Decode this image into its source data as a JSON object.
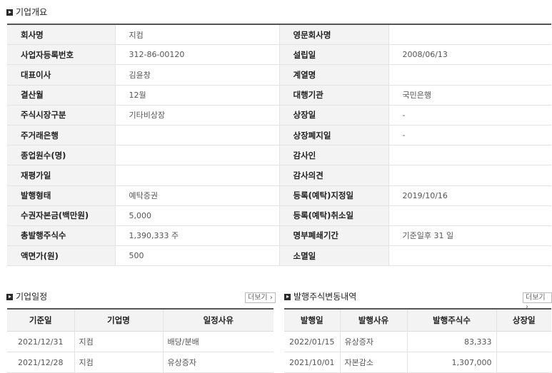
{
  "overview": {
    "title": "기업개요",
    "rows": [
      {
        "l1": "회사명",
        "v1": "지컴",
        "l2": "영문회사명",
        "v2": ""
      },
      {
        "l1": "사업자등록번호",
        "v1": "312-86-00120",
        "l2": "설립일",
        "v2": "2008/06/13"
      },
      {
        "l1": "대표이사",
        "v1": "김윤창",
        "l2": "계열명",
        "v2": ""
      },
      {
        "l1": "결산월",
        "v1": "12월",
        "l2": "대행기관",
        "v2": "국민은행"
      },
      {
        "l1": "주식시장구분",
        "v1": "기타비상장",
        "l2": "상장일",
        "v2": "-"
      },
      {
        "l1": "주거래은행",
        "v1": "",
        "l2": "상장폐지일",
        "v2": "-"
      },
      {
        "l1": "종업원수(명)",
        "v1": "",
        "l2": "감사인",
        "v2": ""
      },
      {
        "l1": "재평가일",
        "v1": "",
        "l2": "감사의견",
        "v2": ""
      },
      {
        "l1": "발행형태",
        "v1": "예탁증권",
        "l2": "등록(예탁)지정일",
        "v2": "2019/10/16"
      },
      {
        "l1": "수권자본금(백만원)",
        "v1": "5,000",
        "l2": "등록(예탁)취소일",
        "v2": ""
      },
      {
        "l1": "총발행주식수",
        "v1": "1,390,333 주",
        "l2": "명부폐쇄기간",
        "v2": "기준일후 31 일"
      },
      {
        "l1": "액면가(원)",
        "v1": "500",
        "l2": "소멸일",
        "v2": ""
      }
    ]
  },
  "schedule": {
    "title": "기업일정",
    "more_label": "더보기",
    "headers": [
      "기준일",
      "기업명",
      "일정사유"
    ],
    "rows": [
      [
        "2021/12/31",
        "지컴",
        "배당/분배"
      ],
      [
        "2021/12/28",
        "지컴",
        "유상증자"
      ]
    ]
  },
  "issuance": {
    "title": "발행주식변동내역",
    "more_label": "더보기",
    "headers": [
      "발행일",
      "발행사유",
      "발행주식수",
      "상장일"
    ],
    "rows": [
      [
        "2022/01/15",
        "유상증자",
        "83,333",
        ""
      ],
      [
        "2021/10/01",
        "자본감소",
        "1,307,000",
        ""
      ]
    ]
  }
}
